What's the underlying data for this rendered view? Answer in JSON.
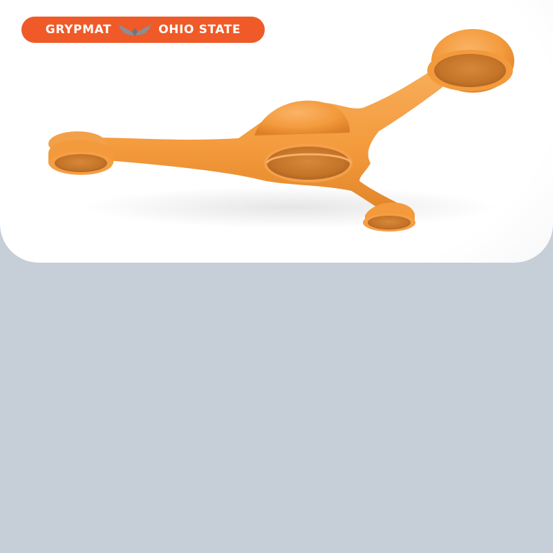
{
  "badge": {
    "left_text": "GRYPMAT",
    "right_text": "OHIO STATE",
    "logo_icon": "wings-icon",
    "background_color": "#ef5a28",
    "text_color": "#ffffff"
  },
  "product": {
    "icon": "tripod-tool-tray-icon",
    "color": "#f59a3f"
  },
  "colors": {
    "page_background": "#c6ced8",
    "card_background": "#ffffff"
  }
}
